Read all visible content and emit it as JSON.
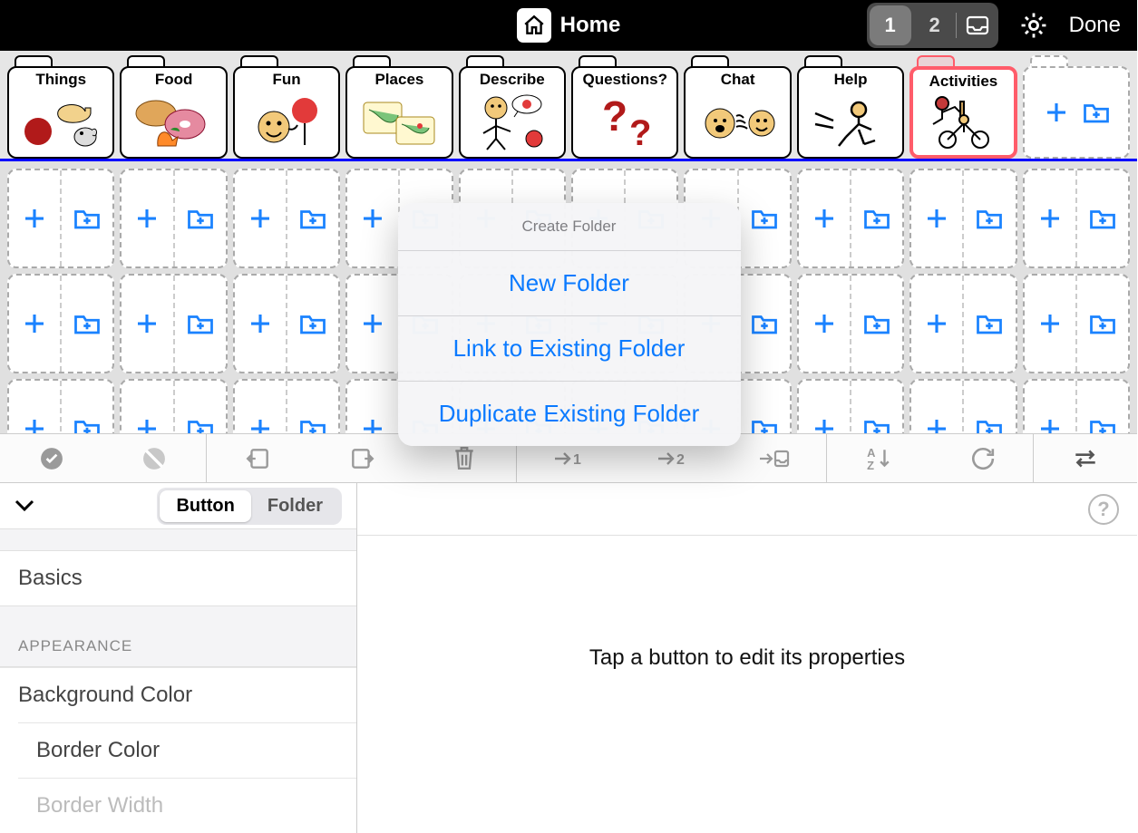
{
  "header": {
    "title": "Home",
    "pages": {
      "active": "1",
      "inactive": "2"
    },
    "done": "Done"
  },
  "folders": [
    {
      "label": "Things"
    },
    {
      "label": "Food"
    },
    {
      "label": "Fun"
    },
    {
      "label": "Places"
    },
    {
      "label": "Describe"
    },
    {
      "label": "Questions?"
    },
    {
      "label": "Chat"
    },
    {
      "label": "Help"
    },
    {
      "label": "Activities"
    }
  ],
  "action_sheet": {
    "title": "Create Folder",
    "items": [
      "New Folder",
      "Link to Existing Folder",
      "Duplicate Existing Folder"
    ]
  },
  "side": {
    "segments": {
      "button": "Button",
      "folder": "Folder"
    },
    "basics": "Basics",
    "appearance_header": "APPEARANCE",
    "bg_color": "Background Color",
    "border_color": "Border Color",
    "border_width": "Border Width"
  },
  "main_msg": "Tap a button to edit its properties"
}
